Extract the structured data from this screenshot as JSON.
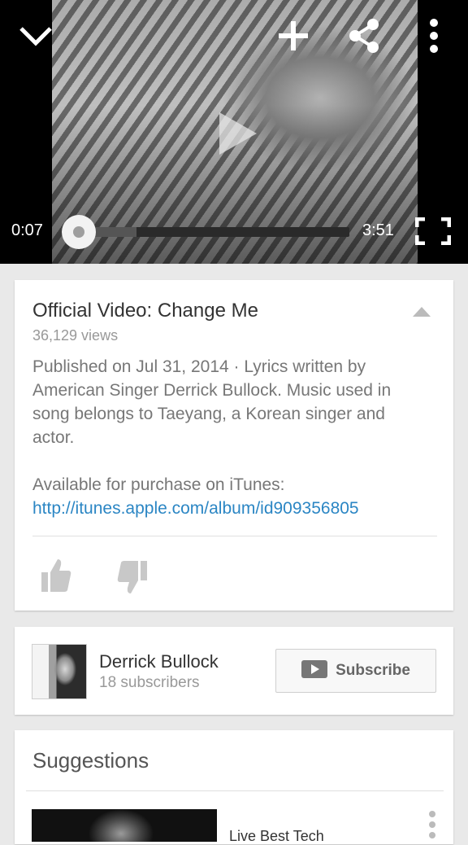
{
  "player": {
    "current_time": "0:07",
    "duration": "3:51",
    "progress_fraction": 0.03,
    "buffered_fraction": 0.2,
    "icons": {
      "collapse": "chevron-down-icon",
      "add": "plus-icon",
      "share": "share-icon",
      "more": "more-vertical-icon",
      "play": "play-icon",
      "fullscreen": "fullscreen-icon"
    }
  },
  "video": {
    "title": "Official Video: Change Me",
    "views": "36,129 views",
    "description_line1": "Published on Jul 31, 2014 · Lyrics written by American Singer Derrick Bullock. Music used in song belongs to Taeyang, a Korean singer and actor.",
    "purchase_prefix": "Available for purchase on iTunes: ",
    "purchase_link": "http://itunes.apple.com/album/id909356805"
  },
  "channel": {
    "name": "Derrick Bullock",
    "subscribers": "18 subscribers",
    "subscribe_label": "Subscribe"
  },
  "suggestions": {
    "heading": "Suggestions",
    "first_item_title": "Live Best Tech"
  },
  "colors": {
    "link": "#2b86c4",
    "player_bg": "#000000",
    "page_bg": "#e9e9e9"
  }
}
